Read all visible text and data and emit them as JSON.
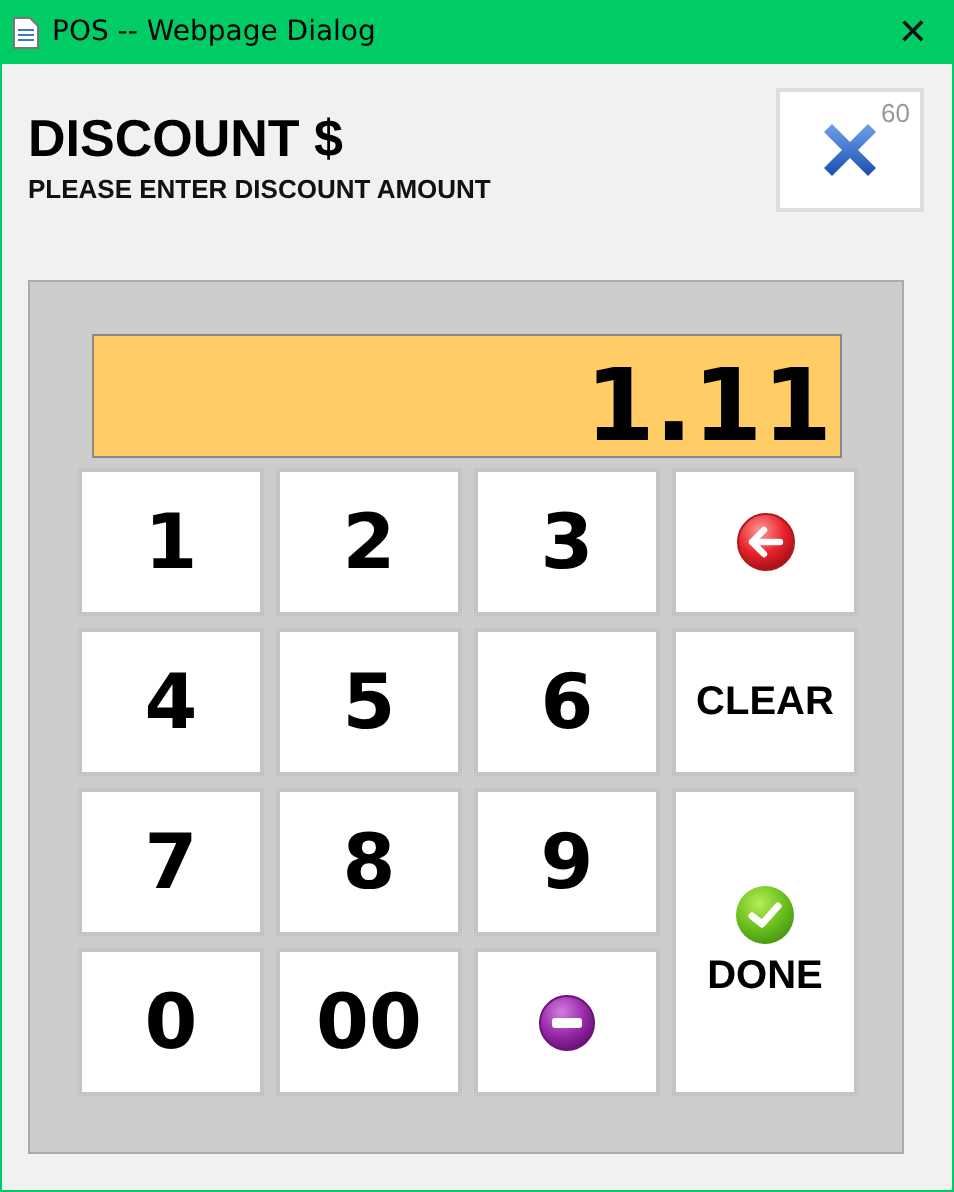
{
  "window": {
    "title": "POS -- Webpage Dialog",
    "close_glyph": "✕"
  },
  "header": {
    "title": "DISCOUNT $",
    "subtitle": "PLEASE ENTER DISCOUNT AMOUNT"
  },
  "cancel_button": {
    "countdown": "60"
  },
  "display": {
    "value": "1.11"
  },
  "keys": [
    {
      "kind": "digit",
      "label": "1"
    },
    {
      "kind": "digit",
      "label": "2"
    },
    {
      "kind": "digit",
      "label": "3"
    },
    {
      "kind": "backspace"
    },
    {
      "kind": "digit",
      "label": "4"
    },
    {
      "kind": "digit",
      "label": "5"
    },
    {
      "kind": "digit",
      "label": "6"
    },
    {
      "kind": "clear",
      "label": "CLEAR"
    },
    {
      "kind": "digit",
      "label": "7"
    },
    {
      "kind": "digit",
      "label": "8"
    },
    {
      "kind": "digit",
      "label": "9"
    },
    {
      "kind": "done",
      "label": "DONE"
    },
    {
      "kind": "digit",
      "label": "0"
    },
    {
      "kind": "digit",
      "label": "00"
    },
    {
      "kind": "minus"
    }
  ]
}
